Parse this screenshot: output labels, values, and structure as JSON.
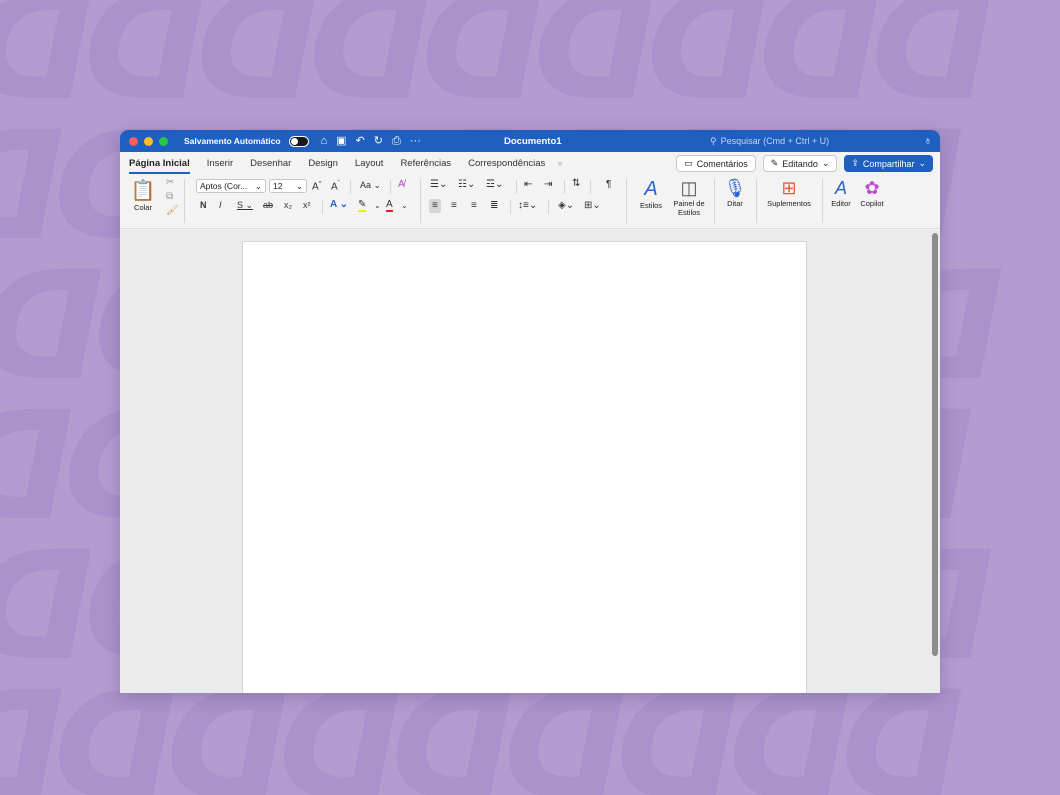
{
  "window": {
    "autosave_label": "Salvamento Automático",
    "doc_title": "Documento1",
    "search_placeholder": "Pesquisar (Cmd + Ctrl + U)"
  },
  "tabs": [
    {
      "label": "Página Inicial",
      "active": true
    },
    {
      "label": "Inserir"
    },
    {
      "label": "Desenhar"
    },
    {
      "label": "Design"
    },
    {
      "label": "Layout"
    },
    {
      "label": "Referências"
    },
    {
      "label": "Correspondências"
    }
  ],
  "tab_actions": {
    "comments": "Comentários",
    "editing": "Editando",
    "share": "Compartilhar"
  },
  "ribbon": {
    "paste_label": "Colar",
    "font_name": "Aptos (Cor...",
    "font_size": "12",
    "case_label": "Aa",
    "bold": "N",
    "italic": "I",
    "underline": "S",
    "styles_label": "Estilos",
    "styles_pane_label": "Painel de Estilos",
    "dictate_label": "Ditar",
    "addins_label": "Suplementos",
    "editor_label": "Editor",
    "copilot_label": "Copilot"
  },
  "colors": {
    "accent": "#1f5fbf",
    "background": "#b39dd0"
  }
}
